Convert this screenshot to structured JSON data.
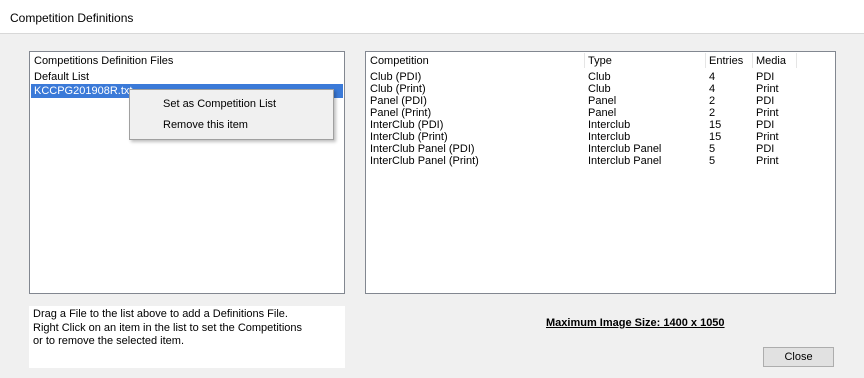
{
  "window": {
    "title": "Competition Definitions"
  },
  "files_panel": {
    "header": "Competitions Definition Files",
    "items": [
      "Default List",
      "KCCPG201908R.txt"
    ],
    "selected_index": 1
  },
  "context_menu": {
    "items": [
      "Set as Competition List",
      "Remove this item"
    ]
  },
  "competitions_panel": {
    "columns": [
      "Competition",
      "Type",
      "Entries",
      "Media"
    ],
    "rows": [
      [
        "Club (PDI)",
        "Club",
        "4",
        "PDI"
      ],
      [
        "Club (Print)",
        "Club",
        "4",
        "Print"
      ],
      [
        "Panel (PDI)",
        "Panel",
        "2",
        "PDI"
      ],
      [
        "Panel (Print)",
        "Panel",
        "2",
        "Print"
      ],
      [
        "InterClub (PDI)",
        "Interclub",
        "15",
        "PDI"
      ],
      [
        "InterClub (Print)",
        "Interclub",
        "15",
        "Print"
      ],
      [
        "InterClub Panel (PDI)",
        "Interclub Panel",
        "5",
        "PDI"
      ],
      [
        "InterClub Panel (Print)",
        "Interclub Panel",
        "5",
        "Print"
      ]
    ]
  },
  "help": {
    "lines": [
      "Drag a File to the list above to add a Definitions File.",
      "Right Click on an item in the list to set the Competitions",
      "or to remove the selected item."
    ]
  },
  "max_image_size": "Maximum Image Size: 1400 x 1050",
  "buttons": {
    "close": "Close"
  }
}
